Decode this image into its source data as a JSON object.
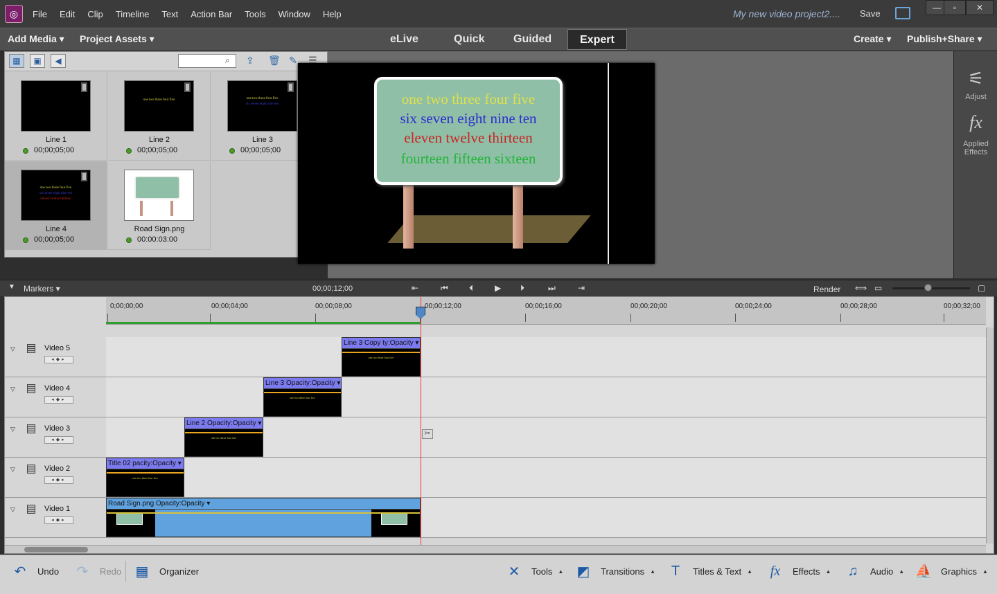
{
  "menubar": {
    "items": [
      "File",
      "Edit",
      "Clip",
      "Timeline",
      "Text",
      "Action Bar",
      "Tools",
      "Window",
      "Help"
    ],
    "project_title": "My new video project2....",
    "save_label": "Save"
  },
  "modebar": {
    "add_media": "Add Media",
    "project_assets": "Project Assets",
    "tabs": [
      "eLive",
      "Quick",
      "Guided",
      "Expert"
    ],
    "active_tab": "Expert",
    "create": "Create",
    "publish": "Publish+Share"
  },
  "assets": {
    "search_value": "",
    "items": [
      {
        "name": "Line 1",
        "duration": "00;00;05;00",
        "thumb_lines": []
      },
      {
        "name": "Line 2",
        "duration": "00;00;05;00",
        "thumb_lines": [
          "one two three four five"
        ]
      },
      {
        "name": "Line 3",
        "duration": "00;00;05;00",
        "thumb_lines": [
          "one two three four five",
          "six seven eight nine ten"
        ]
      },
      {
        "name": "Line 4",
        "duration": "00;00;05;00",
        "thumb_lines": [
          "one two three four five",
          "six seven eight nine ten",
          "eleven twelve thirteen"
        ]
      },
      {
        "name": "Road Sign.png",
        "duration": "00:00:03:00",
        "thumb_lines": []
      }
    ]
  },
  "monitor": {
    "sign_lines": [
      {
        "text": "one two three four five",
        "color": "#e0e04a"
      },
      {
        "text": "six seven eight nine ten",
        "color": "#2c2ccf"
      },
      {
        "text": "eleven twelve thirteen",
        "color": "#c92424"
      },
      {
        "text": "fourteen fifteen sixteen",
        "color": "#25b53a"
      }
    ]
  },
  "right_panel": {
    "adjust": "Adjust",
    "applied_effects": "Applied Effects"
  },
  "timeline_controls": {
    "markers": "Markers",
    "current_time": "00;00;12;00",
    "render": "Render"
  },
  "ruler": {
    "labels": [
      "0;00;00;00",
      "00;00;04;00",
      "00;00;08;00",
      "00;00;12;00",
      "00;00;16;00",
      "00;00;20;00",
      "00;00;24;00",
      "00;00;28;00",
      "00;00;32;00"
    ]
  },
  "tracks": [
    {
      "name": "Video 5",
      "clip": {
        "title": "Line 3 Copy  ty:Opacity",
        "kind": "text"
      }
    },
    {
      "name": "Video 4",
      "clip": {
        "title": "Line 3 Opacity:Opacity",
        "kind": "text"
      }
    },
    {
      "name": "Video 3",
      "clip": {
        "title": "Line 2 Opacity:Opacity",
        "kind": "text"
      }
    },
    {
      "name": "Video 2",
      "clip": {
        "title": "Title 02  pacity:Opacity",
        "kind": "text"
      }
    },
    {
      "name": "Video 1",
      "clip": {
        "title": "Road Sign.png Opacity:Opacity",
        "kind": "image"
      }
    }
  ],
  "bottombar": {
    "undo": "Undo",
    "redo": "Redo",
    "organizer": "Organizer",
    "tools": "Tools",
    "transitions": "Transitions",
    "titles_text": "Titles & Text",
    "effects": "Effects",
    "audio": "Audio",
    "graphics": "Graphics"
  }
}
